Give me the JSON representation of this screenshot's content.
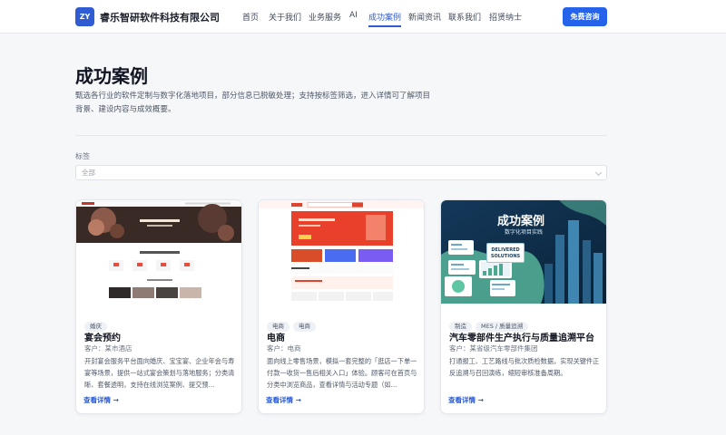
{
  "header": {
    "logo_text": "ZY",
    "company_name": "睿乐智研软件科技有限公司",
    "nav": [
      {
        "label": "首页"
      },
      {
        "label": "关于我们"
      },
      {
        "label": "业务服务"
      },
      {
        "label": "AI"
      },
      {
        "label": "成功案例",
        "active": true
      },
      {
        "label": "新闻资讯"
      },
      {
        "label": "联系我们"
      },
      {
        "label": "招贤纳士"
      }
    ],
    "cta_label": "免费咨询"
  },
  "hero": {
    "title": "成功案例",
    "description": "甄选各行业的软件定制与数字化落地项目，部分信息已脱敏处理；支持按标签筛选，进入详情可了解项目背景、建设内容与成效概要。"
  },
  "filter": {
    "label": "标签",
    "selected": "全部"
  },
  "cards": [
    {
      "tags": [
        "婚庆"
      ],
      "title": "宴会预约",
      "client": "客户：某市酒店",
      "description": "开封宴会服务平台面向婚庆、宝宝宴、企业年会与寿宴等场景，提供一站式宴会策划与落地服务；分类清晰、套餐透明，支持在线浏览案例、提交预...",
      "link_label": "查看详情 →"
    },
    {
      "tags": [
        "电商",
        "电商"
      ],
      "title": "电商",
      "client": "客户：电商",
      "description": "面向线上零售场景，模拟一套完整的「逛店一下单一付款一收货一售后相关入口」体验。顾客可在首页与分类中浏览商品，查看详情与活动专题（如...",
      "link_label": "查看详情 →"
    },
    {
      "tags": [
        "制造",
        "MES / 质量追溯"
      ],
      "title": "汽车零部件生产执行与质量追溯平台",
      "client": "客户：某省级汽车零部件集团",
      "description": "打通报工、工艺路线与批次质检数据，实现关键件正反追溯与召回演练，缩短审核准备周期。",
      "link_label": "查看详情 →",
      "thumb_title": "成功案例",
      "thumb_subtitle": "数字化项目实践",
      "thumb_badge_line1": "DELIVERED",
      "thumb_badge_line2": "SOLUTIONS"
    }
  ],
  "colors": {
    "primary": "#2563eb",
    "nav_active": "#2f5bd3",
    "link": "#2457d6",
    "page_bg": "#f6f7f9"
  }
}
